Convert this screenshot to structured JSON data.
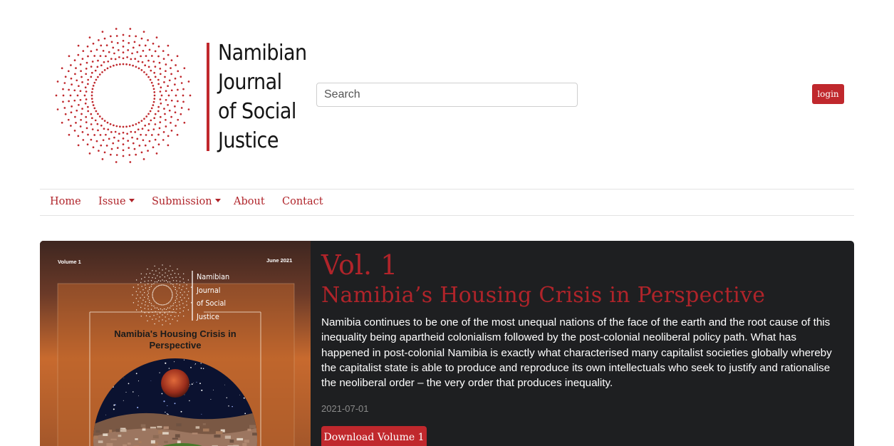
{
  "header": {
    "logo": {
      "lines": [
        "Namibian",
        "Journal",
        "of Social",
        "Justice"
      ],
      "brand_color": "#c0282d"
    },
    "search": {
      "placeholder": "Search",
      "value": ""
    },
    "login_label": "login"
  },
  "nav": {
    "items": [
      {
        "label": "Home",
        "dropdown": false
      },
      {
        "label": "Issue",
        "dropdown": true
      },
      {
        "label": "Submission",
        "dropdown": true
      },
      {
        "label": "About",
        "dropdown": false
      },
      {
        "label": "Contact",
        "dropdown": false
      }
    ]
  },
  "featured_issue": {
    "cover": {
      "volume": "Volume 1",
      "date": "June 2021",
      "logo_lines": [
        "Namibian",
        "Journal",
        "of Social",
        "Justice"
      ],
      "title": "Namibia's Housing Crisis in Perspective"
    },
    "volume_label": "Vol. 1",
    "title": "Namibia’s Housing Crisis in Perspective",
    "description": "Namibia continues to be one of the most unequal nations of the face of the earth and the root cause of this inequality being apartheid colonialism followed by the post-colonial neoliberal policy path. What has happened in post-colonial Namibia is exactly what characterised many capitalist societies globally whereby the capitalist state is able to produce and reproduce its own intellectuals who seek to justify and rationalise the neoliberal order – the very order that produces inequality.",
    "published": "2021-07-01",
    "download_label": "Download Volume 1"
  },
  "colors": {
    "accent": "#c0282d",
    "link": "#b0242a",
    "card_bg": "#1e1f21"
  }
}
